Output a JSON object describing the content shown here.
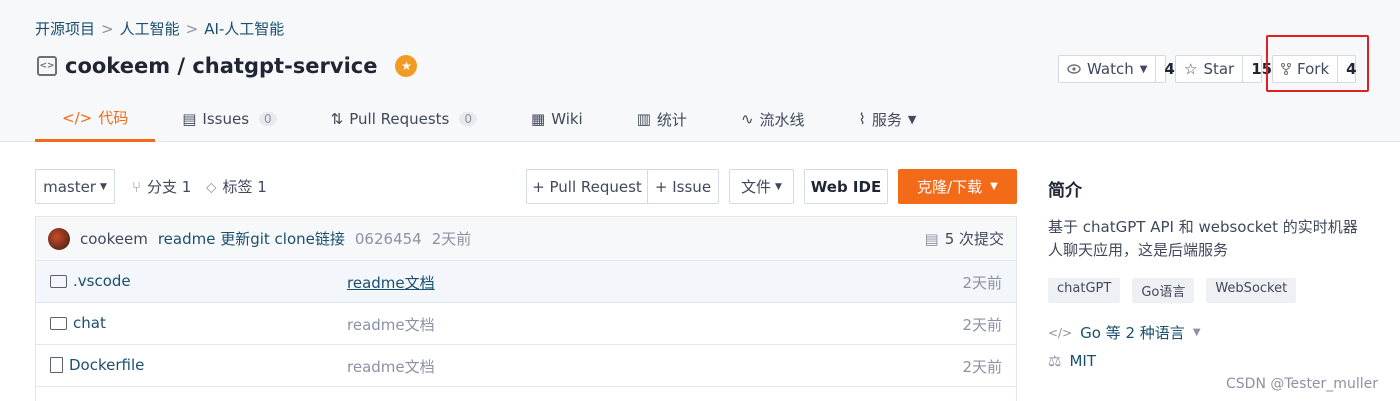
{
  "breadcrumb": [
    "开源项目",
    "人工智能",
    "AI-人工智能"
  ],
  "breadcrumb_sep": ">",
  "repo": {
    "icon_text": "<>",
    "name": "cookeem / chatgpt-service"
  },
  "actions": {
    "watch": {
      "icon": "eye-icon",
      "label": "Watch",
      "count": "4"
    },
    "star": {
      "icon": "star-icon",
      "label": "Star",
      "count": "15"
    },
    "fork": {
      "icon": "fork-icon",
      "label": "Fork",
      "count": "4"
    }
  },
  "tabs": [
    {
      "icon": "</>",
      "label": "代码",
      "count": ""
    },
    {
      "icon": "▤",
      "label": "Issues",
      "count": "0"
    },
    {
      "icon": "⇅",
      "label": "Pull Requests",
      "count": "0"
    },
    {
      "icon": "▦",
      "label": "Wiki",
      "count": ""
    },
    {
      "icon": "▥",
      "label": "统计",
      "count": ""
    },
    {
      "icon": "∿",
      "label": "流水线",
      "count": ""
    },
    {
      "icon": "⌇",
      "label": "服务",
      "count": ""
    }
  ],
  "toolbar": {
    "branch": "master",
    "branches": "分支 1",
    "tags": "标签 1",
    "pull_request": "+ Pull Request",
    "issue": "+ Issue",
    "file": "文件",
    "web_ide": "Web IDE",
    "clone": "克隆/下载"
  },
  "commit": {
    "user": "cookeem",
    "message": "readme 更新git clone链接",
    "hash": "0626454",
    "time": "2天前",
    "count": "5 次提交"
  },
  "files": [
    {
      "type": "folder",
      "name": ".vscode",
      "message": "readme文档",
      "time": "2天前"
    },
    {
      "type": "folder",
      "name": "chat",
      "message": "readme文档",
      "time": "2天前"
    },
    {
      "type": "file",
      "name": "Dockerfile",
      "message": "readme文档",
      "time": "2天前"
    }
  ],
  "sidebar": {
    "title": "简介",
    "description": "基于 chatGPT API 和 websocket 的实时机器人聊天应用，这是后端服务",
    "tags": [
      "chatGPT",
      "Go语言",
      "WebSocket"
    ],
    "language": "Go 等 2 种语言",
    "license": "MIT"
  },
  "watermark": "CSDN @Tester_muller",
  "colors": {
    "accent": "#f36a18",
    "link": "#1a4f6e",
    "highlight": "#e02020"
  }
}
